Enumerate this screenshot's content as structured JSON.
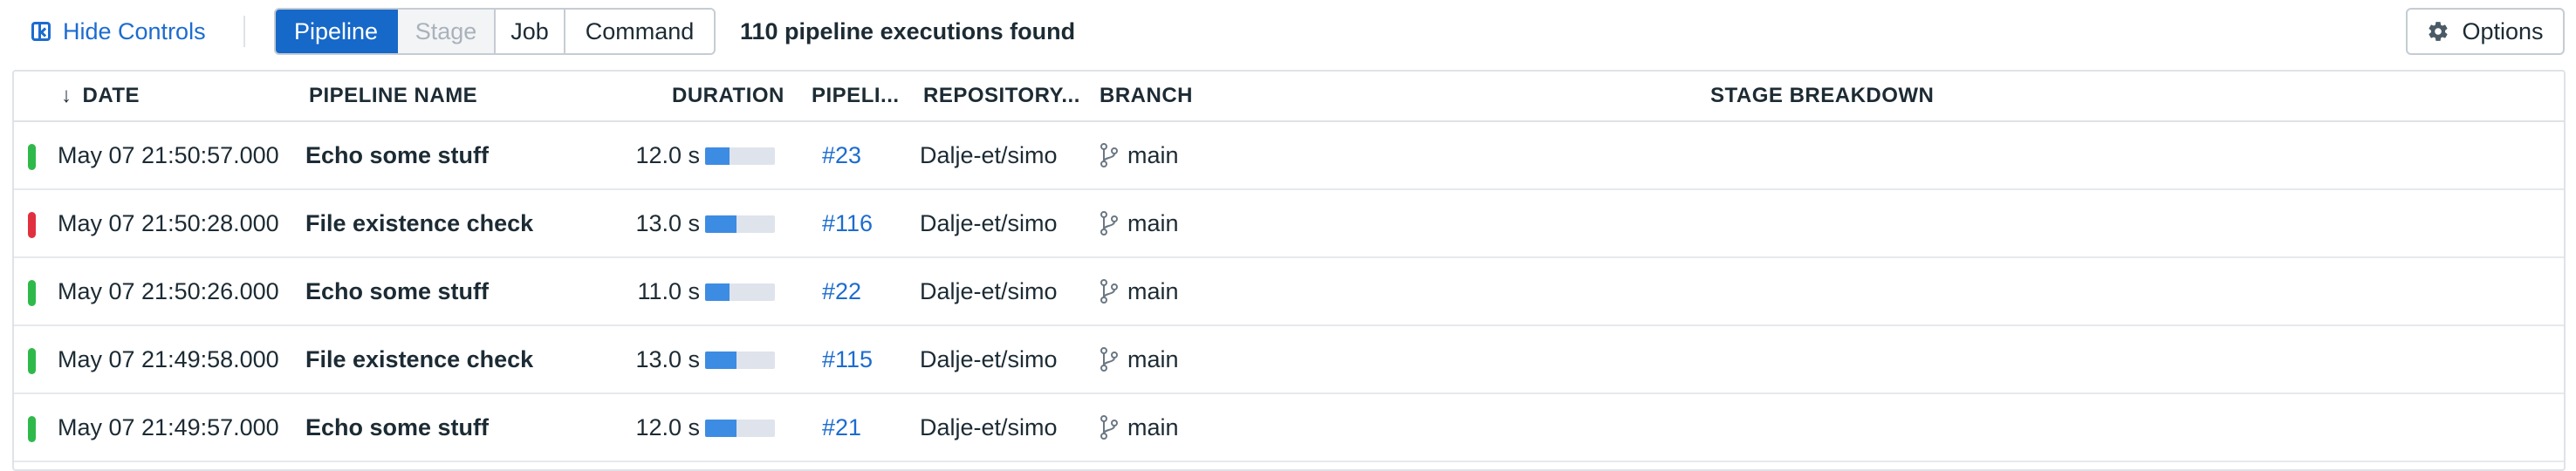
{
  "toolbar": {
    "hide_controls_label": "Hide Controls",
    "views": [
      {
        "label": "Pipeline",
        "state": "active"
      },
      {
        "label": "Stage",
        "state": "disabled"
      },
      {
        "label": "Job",
        "state": "normal"
      },
      {
        "label": "Command",
        "state": "normal"
      }
    ],
    "result_count": "110 pipeline executions found",
    "options_label": "Options"
  },
  "table": {
    "columns": {
      "date": "DATE",
      "pipeline_name": "PIPELINE NAME",
      "duration": "DURATION",
      "pipeline_number": "PIPELI...",
      "repository": "REPOSITORY...",
      "branch": "BRANCH",
      "stage_breakdown": "STAGE BREAKDOWN"
    },
    "sort": {
      "column": "date",
      "direction": "descending"
    },
    "rows": [
      {
        "status": "success",
        "date": "May 07 21:50:57.000",
        "name": "Echo some stuff",
        "duration": "12.0 s",
        "duration_fraction": 0.35,
        "number": "#23",
        "repository": "Dalje-et/simo",
        "branch": "main"
      },
      {
        "status": "error",
        "date": "May 07 21:50:28.000",
        "name": "File existence check",
        "duration": "13.0 s",
        "duration_fraction": 0.45,
        "number": "#116",
        "repository": "Dalje-et/simo",
        "branch": "main"
      },
      {
        "status": "success",
        "date": "May 07 21:50:26.000",
        "name": "Echo some stuff",
        "duration": "11.0 s",
        "duration_fraction": 0.35,
        "number": "#22",
        "repository": "Dalje-et/simo",
        "branch": "main"
      },
      {
        "status": "success",
        "date": "May 07 21:49:58.000",
        "name": "File existence check",
        "duration": "13.0 s",
        "duration_fraction": 0.45,
        "number": "#115",
        "repository": "Dalje-et/simo",
        "branch": "main"
      },
      {
        "status": "success",
        "date": "May 07 21:49:57.000",
        "name": "Echo some stuff",
        "duration": "12.0 s",
        "duration_fraction": 0.45,
        "number": "#21",
        "repository": "Dalje-et/simo",
        "branch": "main"
      }
    ]
  },
  "colors": {
    "success": "#2fb94a",
    "error": "#e0303f",
    "accent": "#1668c9",
    "link": "#1c6ccf",
    "duration_fill": "#3d8ce3",
    "duration_track": "#dfe3ec"
  },
  "icons": {
    "hide_controls": "collapse-panel-icon",
    "options": "gear-icon",
    "sort": "arrow-down-icon",
    "branch": "git-branch-icon"
  }
}
